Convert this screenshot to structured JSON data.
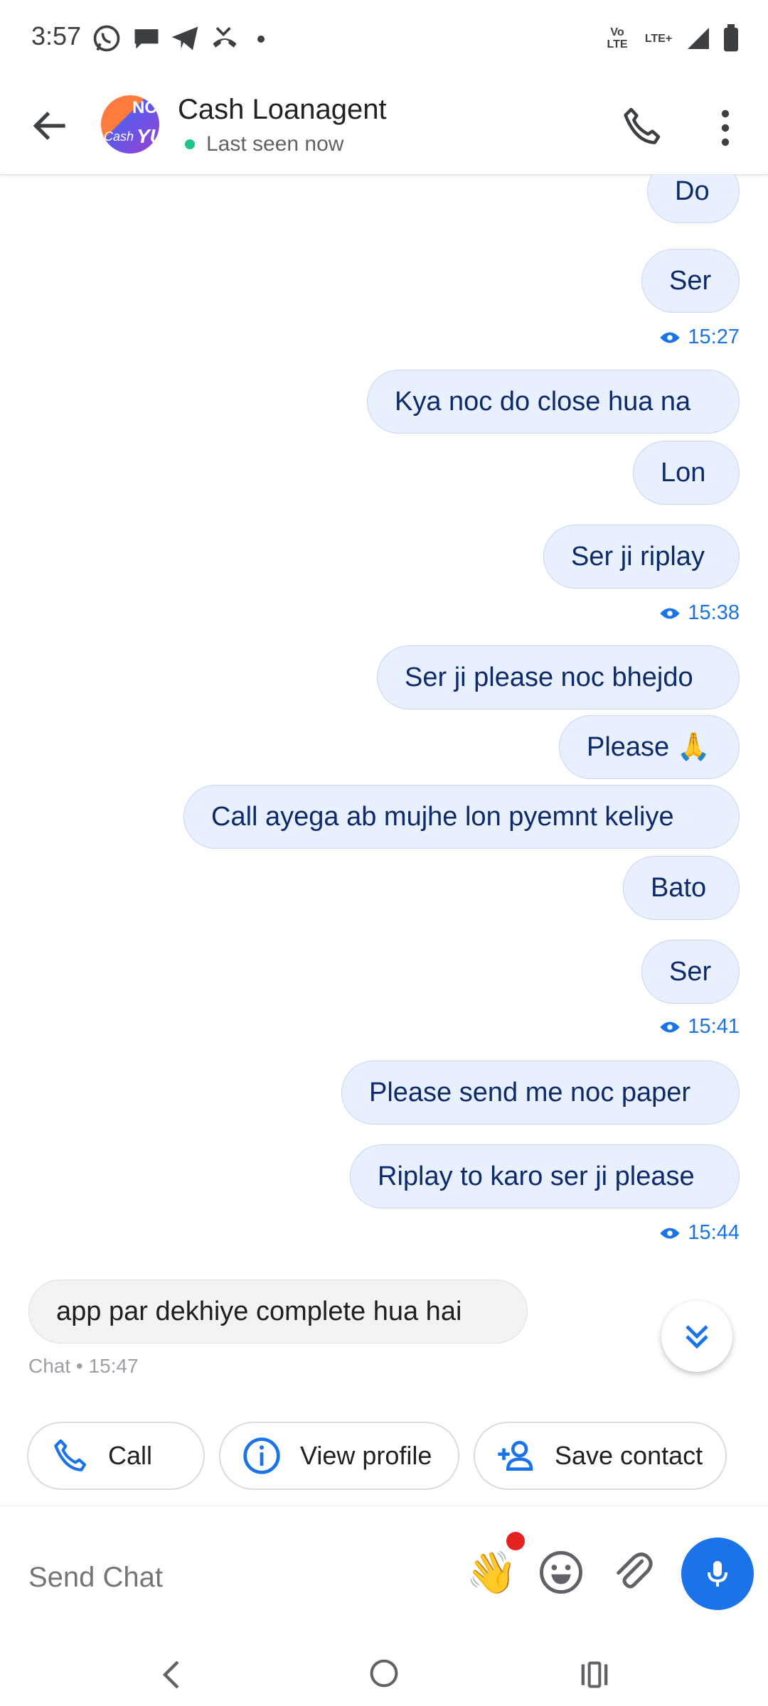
{
  "status_bar": {
    "time": "3:57",
    "network_labels": [
      "Vo LTE",
      "LTE+"
    ]
  },
  "header": {
    "contact_name": "Cash Loanagent",
    "presence": "Last seen now",
    "avatar_text": [
      "NC",
      "Cash",
      "YU"
    ]
  },
  "messages": [
    {
      "text": "Do",
      "direction": "out"
    },
    {
      "text": "Ser",
      "direction": "out"
    },
    {
      "seen_time": "15:27"
    },
    {
      "text": "Kya noc do close hua na",
      "direction": "out"
    },
    {
      "text": "Lon",
      "direction": "out"
    },
    {
      "text": "Ser ji riplay",
      "direction": "out"
    },
    {
      "seen_time": "15:38"
    },
    {
      "text": "Ser ji please noc bhejdo",
      "direction": "out"
    },
    {
      "text": "Please 🙏",
      "direction": "out"
    },
    {
      "text": "Call ayega ab mujhe lon pyemnt keliye",
      "direction": "out"
    },
    {
      "text": "Bato",
      "direction": "out"
    },
    {
      "text": "Ser",
      "direction": "out"
    },
    {
      "seen_time": "15:41"
    },
    {
      "text": "Please send me noc paper",
      "direction": "out"
    },
    {
      "text": "Riplay to karo ser ji please",
      "direction": "out"
    },
    {
      "seen_time": "15:44"
    },
    {
      "text": "app par dekhiye complete hua hai",
      "direction": "in"
    }
  ],
  "incoming_meta": "Chat • 15:47",
  "quick_actions": {
    "call": "Call",
    "view_profile": "View profile",
    "save_contact": "Save contact"
  },
  "input": {
    "placeholder": "Send Chat"
  },
  "colors": {
    "accent": "#1a73e8",
    "outgoing_bubble": "#e8f0fe",
    "incoming_bubble": "#f1f3f4",
    "presence_online": "#1ec28b",
    "notification_dot": "#e52222"
  },
  "icons": [
    "whatsapp-icon",
    "chat-icon",
    "telegram-icon",
    "missed-call-icon",
    "signal-icon",
    "battery-icon",
    "back-arrow-icon",
    "phone-icon",
    "more-vert-icon",
    "eye-icon",
    "chevron-double-down-icon",
    "info-icon",
    "person-add-icon",
    "wave-emoji-icon",
    "emoji-icon",
    "paperclip-icon",
    "mic-icon",
    "nav-back-icon",
    "nav-home-icon",
    "nav-recents-icon"
  ]
}
